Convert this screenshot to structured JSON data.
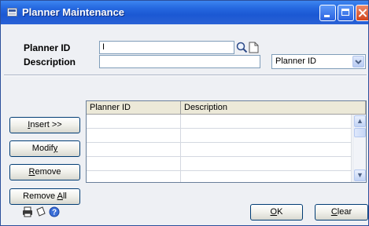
{
  "window": {
    "title": "Planner Maintenance",
    "controls": [
      "minimize",
      "maximize",
      "close"
    ]
  },
  "form": {
    "planner_id": {
      "label": "Planner ID",
      "value": "I"
    },
    "description": {
      "label": "Description",
      "value": ""
    },
    "sort_select": {
      "value": "Planner ID"
    }
  },
  "buttons": {
    "insert": {
      "mnemonic": "I",
      "rest": "nsert >>"
    },
    "modify": {
      "before": "Modif",
      "mnemonic": "y",
      "after": ""
    },
    "remove": {
      "mnemonic": "R",
      "rest": "emove"
    },
    "remove_all": {
      "before": "Remove ",
      "mnemonic": "A",
      "after": "ll"
    },
    "ok": {
      "mnemonic": "O",
      "rest": "K"
    },
    "clear": {
      "mnemonic": "C",
      "rest": "lear"
    }
  },
  "grid": {
    "columns": [
      "Planner ID",
      "Description"
    ],
    "rows": [
      [
        "",
        ""
      ],
      [
        "",
        ""
      ],
      [
        "",
        ""
      ],
      [
        "",
        ""
      ],
      [
        "",
        ""
      ]
    ]
  },
  "footer_icons": [
    "printer-icon",
    "note-icon",
    "help-icon"
  ]
}
